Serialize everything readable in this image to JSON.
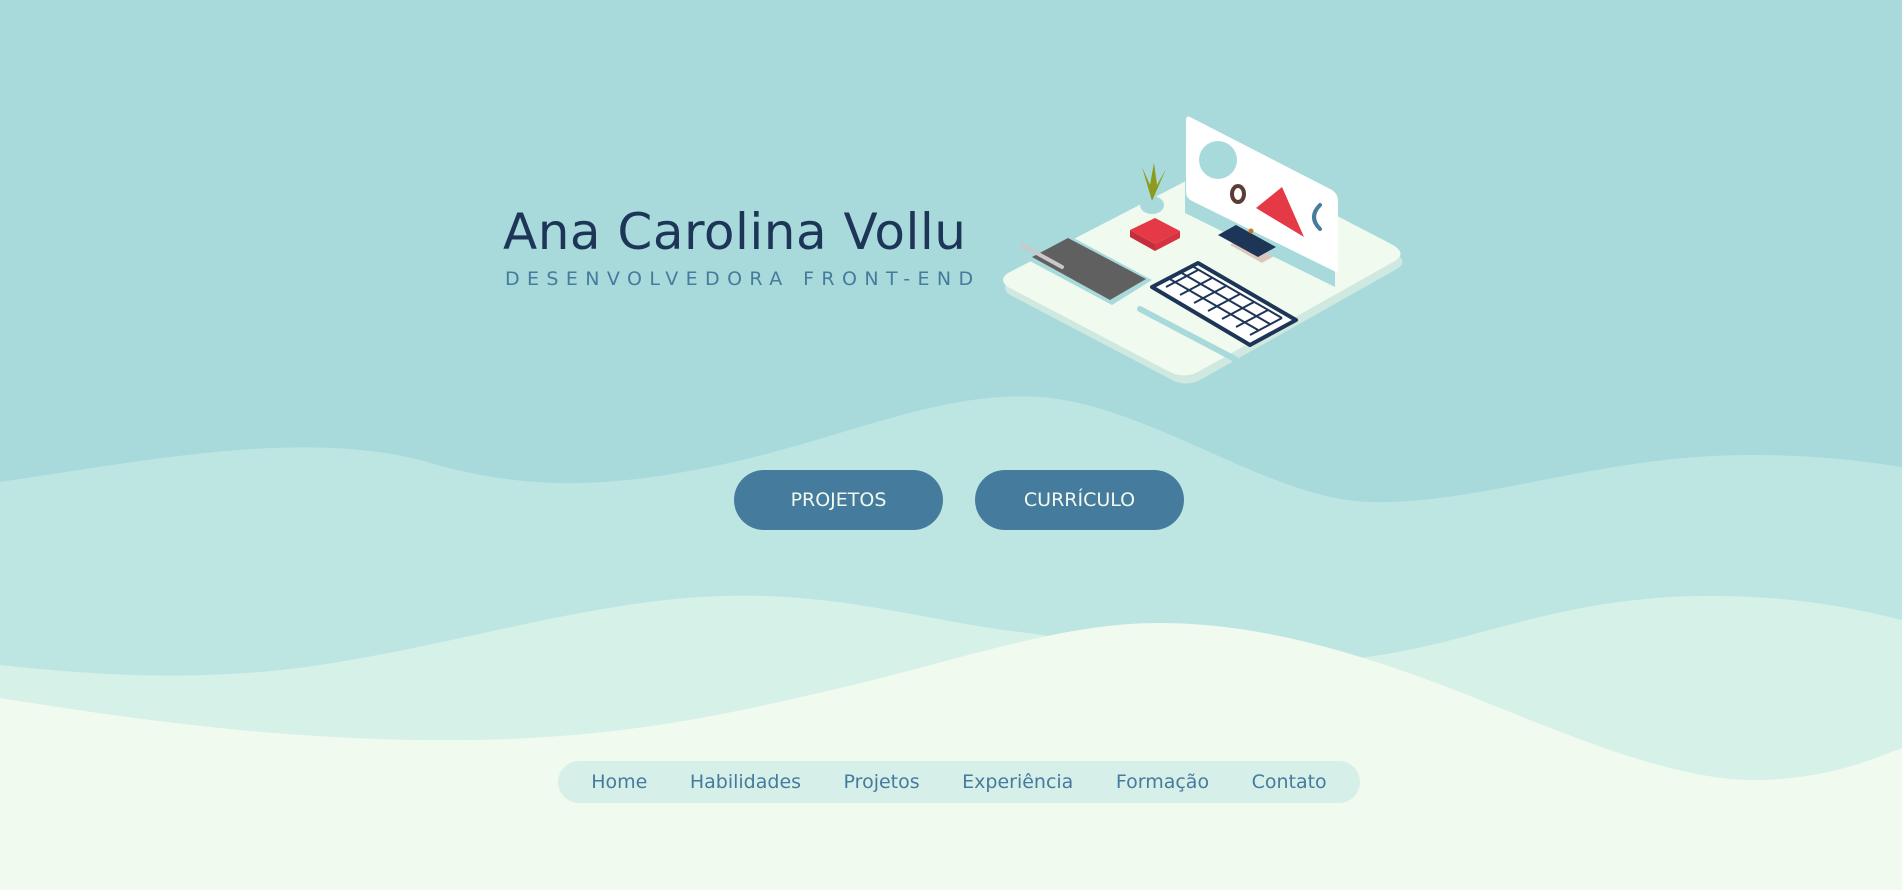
{
  "hero": {
    "name": "Ana Carolina Vollu",
    "role": "DESENVOLVEDORA FRONT-END"
  },
  "buttons": {
    "projetos": "PROJETOS",
    "curriculo": "CURRÍCULO"
  },
  "nav": {
    "items": [
      {
        "label": "Home"
      },
      {
        "label": "Habilidades"
      },
      {
        "label": "Projetos"
      },
      {
        "label": "Experiência"
      },
      {
        "label": "Formação"
      },
      {
        "label": "Contato"
      }
    ]
  },
  "colors": {
    "background_top": "#a8dadc",
    "wave_mid": "#bde6e3",
    "wave_light": "#d6f1e8",
    "wave_lightest": "#f1faee",
    "text_dark": "#1d3557",
    "accent": "#457b9d",
    "accent_red": "#e63946"
  },
  "illustration": {
    "icon": "isometric-workspace-illustration"
  }
}
